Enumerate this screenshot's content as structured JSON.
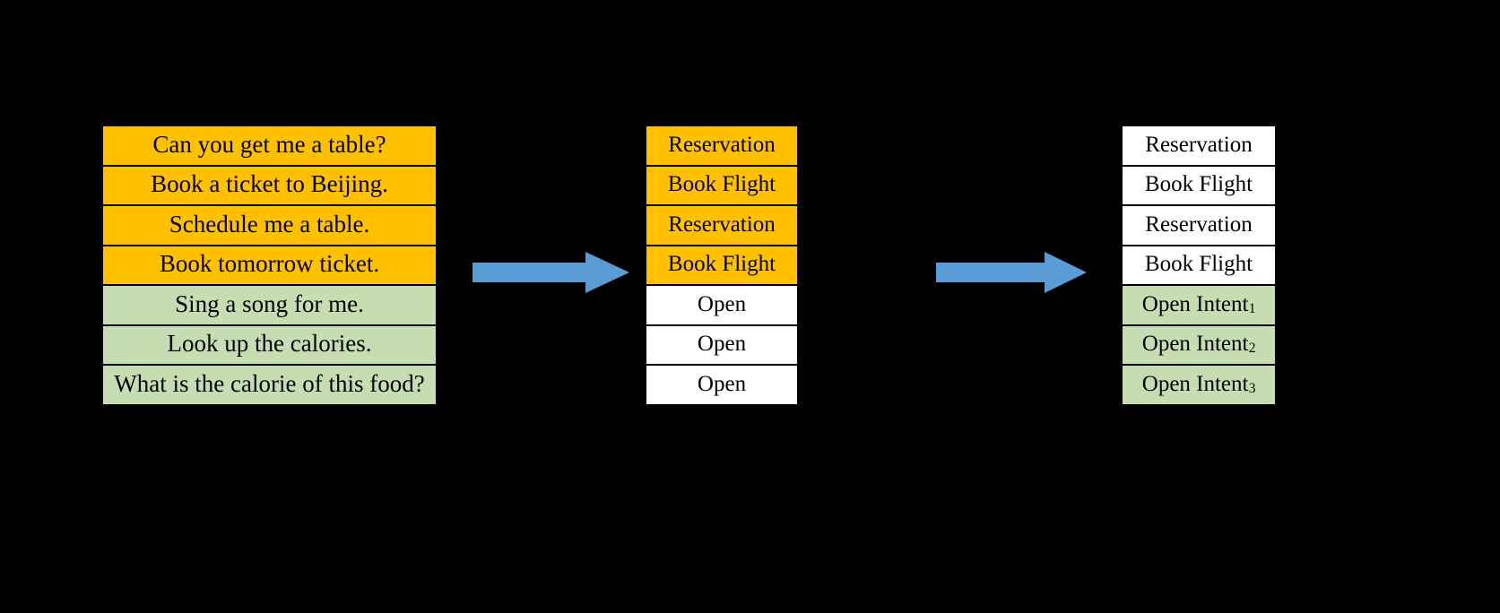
{
  "figure": {
    "background_color": "#000000",
    "colors": {
      "known_intent_fill": "#FFC000",
      "open_intent_fill": "#C6DDB2",
      "plain_fill": "#FFFFFF",
      "arrow_fill": "#5B9BD5",
      "border": "#000000",
      "text": "#000000"
    }
  },
  "columns": {
    "utterances": {
      "name": "utterances",
      "cells": [
        {
          "text": "Can you get me a table?",
          "fill": "known"
        },
        {
          "text": "Book a ticket to Beijing.",
          "fill": "known"
        },
        {
          "text": "Schedule me a table.",
          "fill": "known"
        },
        {
          "text": "Book tomorrow ticket.",
          "fill": "known"
        },
        {
          "text": "Sing a song for me.",
          "fill": "open"
        },
        {
          "text": "Look up the calories.",
          "fill": "open"
        },
        {
          "text": "What is the calorie of this food?",
          "fill": "open"
        }
      ]
    },
    "coarse_labels": {
      "name": "coarse-labels",
      "cells": [
        {
          "text": "Reservation",
          "fill": "known"
        },
        {
          "text": "Book Flight",
          "fill": "known"
        },
        {
          "text": "Reservation",
          "fill": "known"
        },
        {
          "text": "Book Flight",
          "fill": "known"
        },
        {
          "text": "Open",
          "fill": "plain"
        },
        {
          "text": "Open",
          "fill": "plain"
        },
        {
          "text": "Open",
          "fill": "plain"
        }
      ]
    },
    "fine_labels": {
      "name": "fine-labels",
      "cells": [
        {
          "text": "Reservation",
          "sub": "",
          "fill": "plain"
        },
        {
          "text": "Book Flight",
          "sub": "",
          "fill": "plain"
        },
        {
          "text": "Reservation",
          "sub": "",
          "fill": "plain"
        },
        {
          "text": "Book Flight",
          "sub": "",
          "fill": "plain"
        },
        {
          "text": "Open Intent",
          "sub": "1",
          "fill": "open"
        },
        {
          "text": "Open Intent",
          "sub": "2",
          "fill": "open"
        },
        {
          "text": "Open Intent",
          "sub": "3",
          "fill": "open"
        }
      ]
    }
  },
  "arrows": [
    {
      "name": "arrow-utterances-to-coarse",
      "direction": "right",
      "color": "#5B9BD5"
    },
    {
      "name": "arrow-coarse-to-fine",
      "direction": "right",
      "color": "#5B9BD5"
    }
  ]
}
